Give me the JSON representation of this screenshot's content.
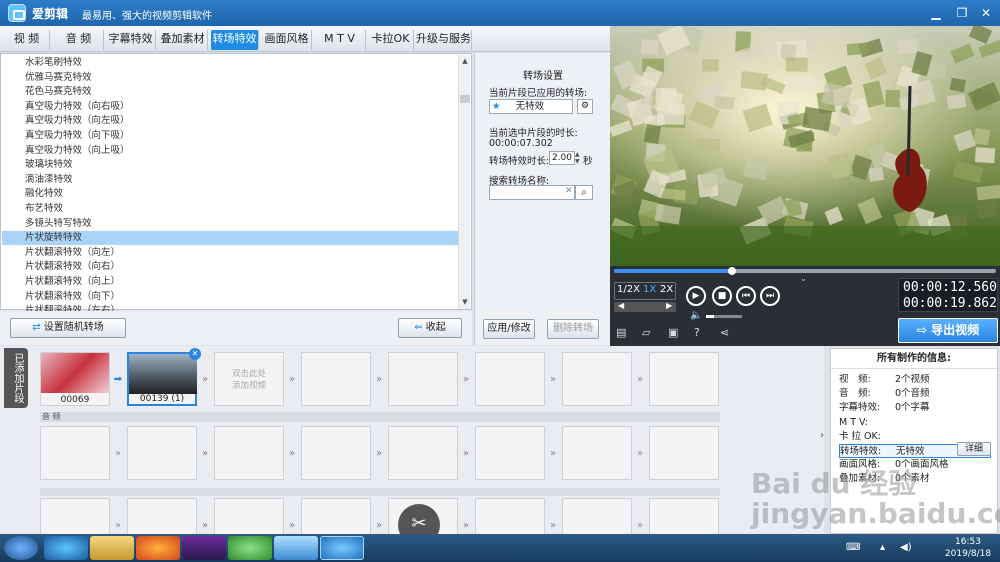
{
  "title_bar": {
    "app_name": "爱剪辑",
    "slogan": "最易用、强大的视频剪辑软件",
    "minimize": "▁",
    "maximize": "❐",
    "close": "✕"
  },
  "tabs": [
    "视 频",
    "音 频",
    "字幕特效",
    "叠加素材",
    "转场特效",
    "画面风格",
    "M T V",
    "卡拉OK",
    "升级与服务"
  ],
  "active_tab": "转场特效",
  "effect_list": [
    "水彩笔刷特效",
    "优雅马赛克特效",
    "花色马赛克特效",
    "真空吸力特效（向右吸）",
    "真空吸力特效（向左吸）",
    "真空吸力特效（向下吸）",
    "真空吸力特效（向上吸）",
    "玻璃块特效",
    "滴油漆特效",
    "融化特效",
    "布艺特效",
    "多镜头特写特效",
    "片状旋转特效",
    "片状翻滚特效（向左）",
    "片状翻滚特效（向右）",
    "片状翻滚特效（向上）",
    "片状翻滚特效（向下）",
    "片状翻滚特效（左右）"
  ],
  "selected_effect": "片状旋转特效",
  "list_buttons": {
    "random": "设置随机转场",
    "collapse": "收起"
  },
  "settings": {
    "title": "转场设置",
    "applied_label": "当前片段已应用的转场:",
    "applied_value": "无特效",
    "duration_label": "当前选中片段的时长:",
    "duration_value": "00:00:07.302",
    "effect_duration_label": "转场特效时长:",
    "effect_duration_value": "2.00",
    "effect_duration_unit": "秒",
    "search_label": "搜索转场名称:",
    "search_value": "",
    "apply_button": "应用/修改",
    "delete_button": "删除转场"
  },
  "player": {
    "progress": 0.31,
    "speeds": [
      "1/2X",
      "1X",
      "2X"
    ],
    "active_speed": "1X",
    "current_time": "00:00:12.560",
    "total_time": "00:00:19.862",
    "export_label": "导出视频"
  },
  "timeline": {
    "label": "已添加片段",
    "clips": [
      {
        "name": "00069"
      },
      {
        "name": "00139 (1)"
      }
    ],
    "add_hint": "双击此处\n添加视频",
    "audio_label": "音 频"
  },
  "info": {
    "title": "所有制作的信息:",
    "rows": [
      {
        "k": "视　频:",
        "v": "2个视频"
      },
      {
        "k": "音　频:",
        "v": "0个音频"
      },
      {
        "k": "字幕特效:",
        "v": "0个字幕"
      },
      {
        "k": "M T V:",
        "v": ""
      },
      {
        "k": "卡 拉 OK:",
        "v": ""
      },
      {
        "k": "转场特效:",
        "v": "无特效"
      },
      {
        "k": "画面风格:",
        "v": "0个画面风格"
      },
      {
        "k": "叠加素材:",
        "v": "0个素材"
      }
    ],
    "detail_button": "详细"
  },
  "watermark": "Bai du 经验\njingyan.baidu.com",
  "clock": {
    "time": "16:53",
    "date": "2019/8/18"
  }
}
